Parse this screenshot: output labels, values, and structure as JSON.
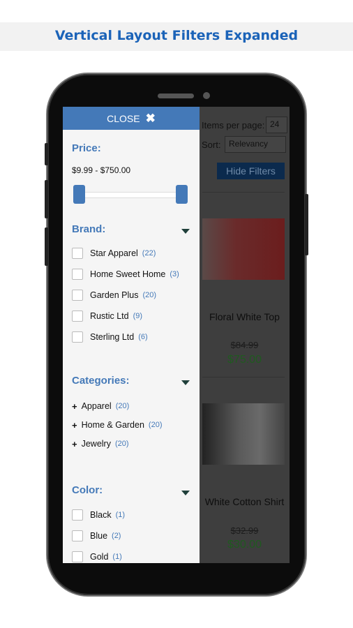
{
  "banner": {
    "title": "Vertical Layout Filters Expanded"
  },
  "colors": {
    "accent": "#4479b8",
    "banner_text": "#1b63b8",
    "price_green": "#2b8a2b",
    "hide_button": "#0a4ea8"
  },
  "background_page": {
    "items_per_page_label": "Items per page:",
    "items_per_page_value": "24",
    "sort_label": "Sort:",
    "sort_value": "Relevancy",
    "hide_filters_label": "Hide Filters",
    "products": [
      {
        "name": "Floral White Top",
        "old_price": "$84.99",
        "price": "$75.00"
      },
      {
        "name": "White Cotton Shirt",
        "old_price": "$32.99",
        "price": "$30.00"
      }
    ]
  },
  "drawer": {
    "close_label": "CLOSE",
    "close_icon": "✖",
    "price": {
      "title": "Price:",
      "range": "$9.99 - $750.00",
      "min_fraction": 0,
      "max_fraction": 1
    },
    "brand": {
      "title": "Brand:",
      "items": [
        {
          "label": "Star Apparel",
          "count": "(22)"
        },
        {
          "label": "Home Sweet Home",
          "count": "(3)"
        },
        {
          "label": "Garden Plus",
          "count": "(20)"
        },
        {
          "label": "Rustic Ltd",
          "count": "(9)"
        },
        {
          "label": "Sterling Ltd",
          "count": "(6)"
        }
      ]
    },
    "categories": {
      "title": "Categories:",
      "items": [
        {
          "label": "Apparel",
          "count": "(20)"
        },
        {
          "label": "Home & Garden",
          "count": "(20)"
        },
        {
          "label": "Jewelry",
          "count": "(20)"
        }
      ]
    },
    "color": {
      "title": "Color:",
      "items": [
        {
          "label": "Black",
          "count": "(1)"
        },
        {
          "label": "Blue",
          "count": "(2)"
        },
        {
          "label": "Gold",
          "count": "(1)"
        }
      ]
    }
  }
}
